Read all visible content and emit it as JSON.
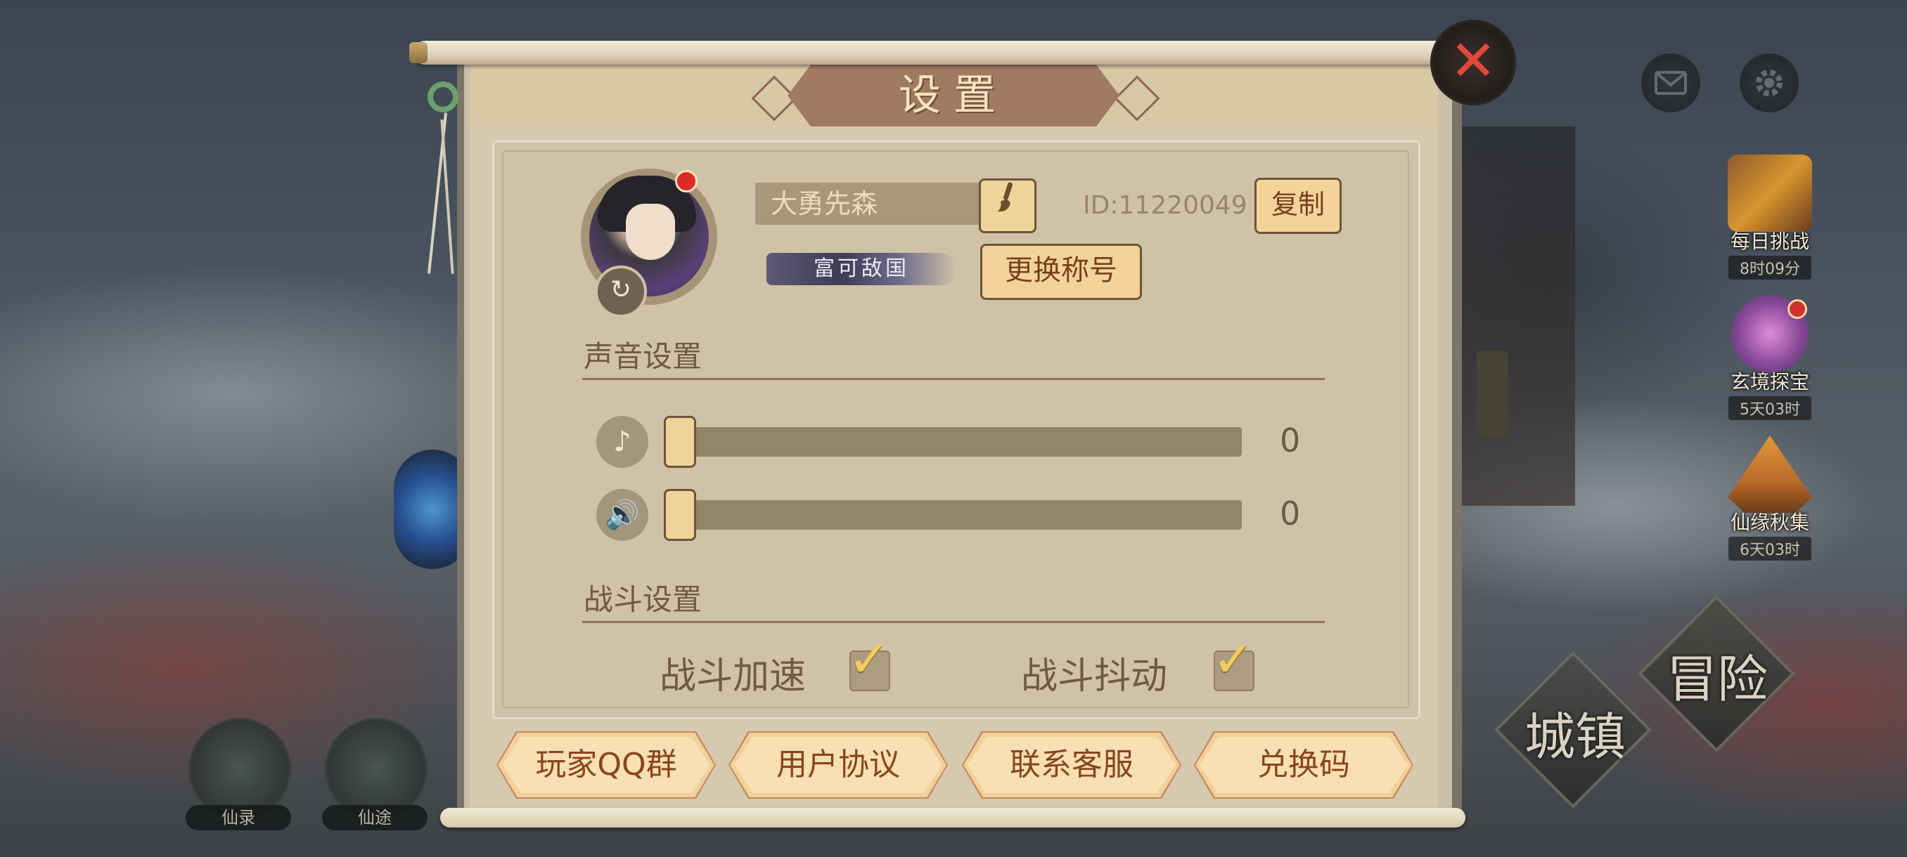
{
  "dialog": {
    "title": "设置",
    "close_icon": "close-x"
  },
  "profile": {
    "player_name": "大勇先森",
    "player_id": "ID:11220049",
    "copy_label": "复制",
    "title_badge": "富可敌国",
    "change_title_label": "更换称号",
    "edit_icon": "brush-icon",
    "refresh_icon": "refresh-icon"
  },
  "sound": {
    "section_title": "声音设置",
    "music": {
      "icon": "music-note-icon",
      "value": "0",
      "level": 0
    },
    "effects": {
      "icon": "speaker-icon",
      "value": "0",
      "level": 0
    }
  },
  "battle": {
    "section_title": "战斗设置",
    "speedup": {
      "label": "战斗加速",
      "checked": true
    },
    "shake": {
      "label": "战斗抖动",
      "checked": true
    }
  },
  "bottom_buttons": [
    {
      "label": "玩家QQ群"
    },
    {
      "label": "用户协议"
    },
    {
      "label": "联系客服"
    },
    {
      "label": "兑换码"
    }
  ],
  "side_events": [
    {
      "name": "每日挑战",
      "time": "8时09分"
    },
    {
      "name": "玄境探宝",
      "time": "5天03时"
    },
    {
      "name": "仙缘秋集",
      "time": "6天03时"
    }
  ],
  "nav": {
    "town": "城镇",
    "adventure": "冒险",
    "xianlu": "仙录",
    "xiantu": "仙途"
  },
  "top_icons": {
    "mail": "mail-icon",
    "settings": "gear-icon"
  },
  "colors": {
    "accent_button": "#f2d49a",
    "panel": "#d6c9af",
    "close": "#e4473a"
  }
}
